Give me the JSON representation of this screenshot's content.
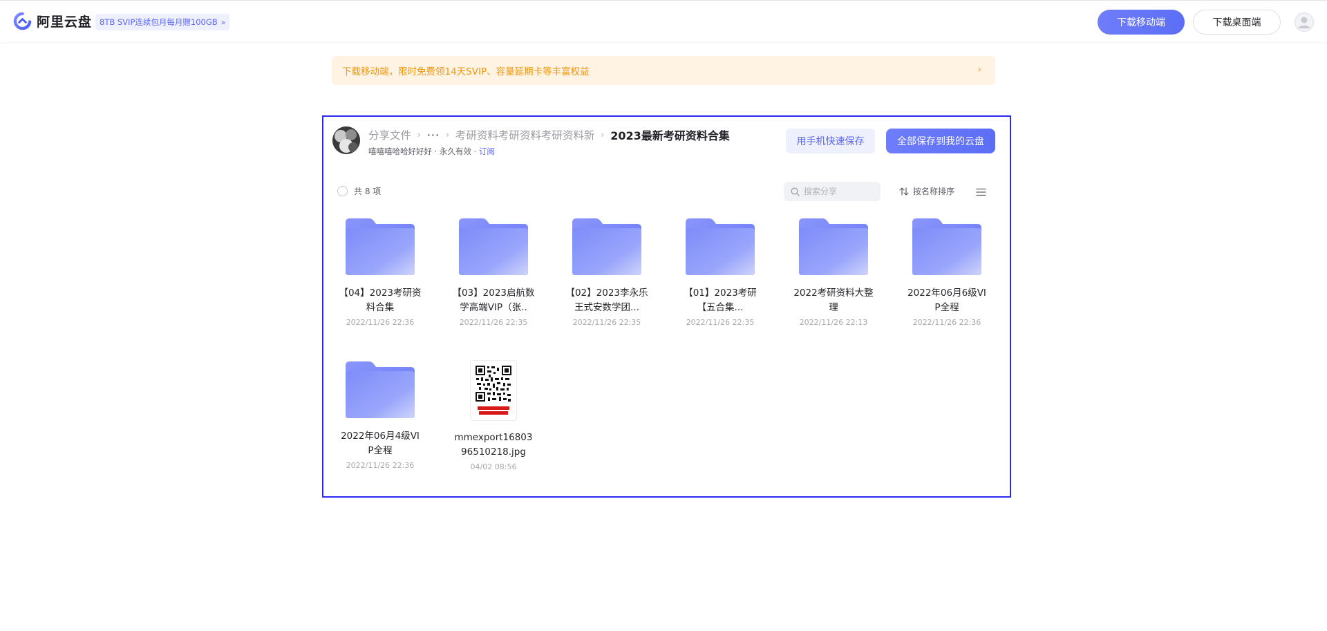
{
  "header": {
    "app_name": "阿里云盘",
    "promo": "8TB SVIP连续包月每月赠100GB",
    "download_mobile": "下载移动端",
    "download_desktop": "下载桌面端"
  },
  "banner": {
    "text": "下载移动端，限时免费领14天SVIP、容量延期卡等丰富权益"
  },
  "share": {
    "breadcrumb": [
      "分享文件",
      "···",
      "考研资料考研资料考研资料新",
      "2023最新考研资料合集"
    ],
    "owner": "嘻嘻嘻哈哈好好好",
    "validity": "永久有效",
    "subscribe": "订阅",
    "save_phone": "用手机快速保存",
    "save_all": "全部保存到我的云盘",
    "count": "共 8 项",
    "search_placeholder": "搜索分享",
    "sort": "按名称排序"
  },
  "items": [
    {
      "name": "【04】2023考研资料合集",
      "date": "2022/11/26 22:36",
      "type": "folder"
    },
    {
      "name": "【03】2023启航数学高端VIP（张..",
      "date": "2022/11/26 22:35",
      "type": "folder"
    },
    {
      "name": "【02】2023李永乐王式安数学团...",
      "date": "2022/11/26 22:35",
      "type": "folder"
    },
    {
      "name": "【01】2023考研【五合集...",
      "date": "2022/11/26 22:35",
      "type": "folder"
    },
    {
      "name": "2022考研资料大整理",
      "date": "2022/11/26 22:13",
      "type": "folder"
    },
    {
      "name": "2022年06月6级VIP全程",
      "date": "2022/11/26 22:36",
      "type": "folder"
    },
    {
      "name": "2022年06月4级VIP全程",
      "date": "2022/11/26 22:36",
      "type": "folder"
    },
    {
      "name": "mmexport1680396510218.jpg",
      "date": "04/02 08:56",
      "type": "image"
    }
  ],
  "colors": {
    "accent": "#5b6ef6",
    "banner_text": "#f0960c",
    "panel_border": "#2929f0"
  }
}
